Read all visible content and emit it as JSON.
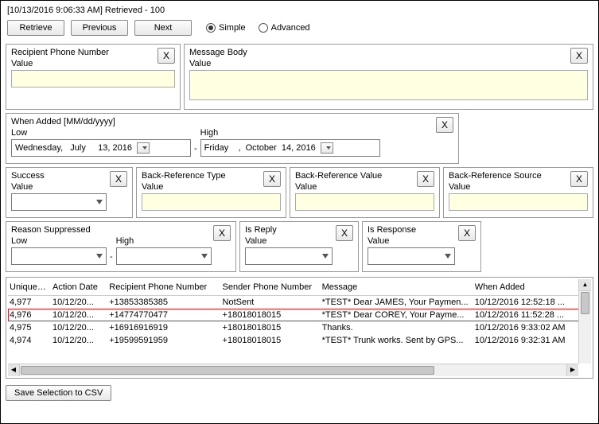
{
  "title": "[10/13/2016 9:06:33 AM] Retrieved - 100",
  "toolbar": {
    "retrieve": "Retrieve",
    "previous": "Previous",
    "next": "Next",
    "simple": "Simple",
    "advanced": "Advanced"
  },
  "filters": {
    "recipientPhone": {
      "label": "Recipient Phone Number",
      "sub": "Value",
      "value": ""
    },
    "messageBody": {
      "label": "Message Body",
      "sub": "Value",
      "value": ""
    },
    "whenAdded": {
      "label": "When Added [MM/dd/yyyy]",
      "lowLabel": "Low",
      "highLabel": "High",
      "lowValue": "Wednesday,   July     13, 2016",
      "highValue": "Friday    ,  October  14, 2016"
    },
    "success": {
      "label": "Success",
      "sub": "Value",
      "value": ""
    },
    "backRefType": {
      "label": "Back-Reference Type",
      "sub": "Value",
      "value": ""
    },
    "backRefValue": {
      "label": "Back-Reference Value",
      "sub": "Value",
      "value": ""
    },
    "backRefSource": {
      "label": "Back-Reference Source",
      "sub": "Value",
      "value": ""
    },
    "reasonSuppressed": {
      "label": "Reason Suppressed",
      "lowLabel": "Low",
      "highLabel": "High"
    },
    "isReply": {
      "label": "Is Reply",
      "sub": "Value"
    },
    "isResponse": {
      "label": "Is Response",
      "sub": "Value"
    }
  },
  "grid": {
    "headers": {
      "key": "Unique Key",
      "actionDate": "Action Date",
      "rpn": "Recipient Phone Number",
      "spn": "Sender Phone Number",
      "msg": "Message",
      "whenAdded": "When Added"
    },
    "rows": [
      {
        "key": "4,977",
        "actionDate": "10/12/20...",
        "rpn": "+13853385385",
        "spn": "NotSent",
        "msg": "*TEST* Dear JAMES, Your Paymen...",
        "whenAdded": "10/12/2016 12:52:18 ..."
      },
      {
        "key": "4,976",
        "actionDate": "10/12/20...",
        "rpn": "+14774770477",
        "spn": "+18018018015",
        "msg": "*TEST* Dear COREY, Your Payme...",
        "whenAdded": "10/12/2016 11:52:28 ...",
        "highlight": true
      },
      {
        "key": "4,975",
        "actionDate": "10/12/20...",
        "rpn": "+16916916919",
        "spn": "+18018018015",
        "msg": "Thanks.",
        "whenAdded": "10/12/2016 9:33:02 AM"
      },
      {
        "key": "4,974",
        "actionDate": "10/12/20...",
        "rpn": "+19599591959",
        "spn": "+18018018015",
        "msg": "*TEST* Trunk works.  Sent by GPS...",
        "whenAdded": "10/12/2016 9:32:31 AM"
      }
    ]
  },
  "footer": {
    "saveCsv": "Save Selection to CSV"
  }
}
